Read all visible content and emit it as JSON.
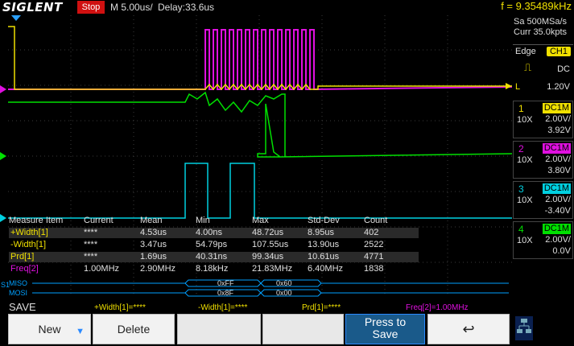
{
  "header": {
    "brand": "SIGLENT",
    "run_state": "Stop",
    "timebase": "M 5.00us/",
    "delay": "Delay:33.6us",
    "frequency": "f = 9.35489kHz"
  },
  "acq": {
    "sample_rate": "Sa 500MSa/s",
    "curr": "Curr 35.0kpts"
  },
  "trigger": {
    "mode": "Edge",
    "source": "CH1",
    "coupling": "DC",
    "level_label": "L",
    "level": "1.20V"
  },
  "channels": [
    {
      "num": "1",
      "coupling": "DC1M",
      "probe": "10X",
      "scale": "2.00V/",
      "offset": "3.92V",
      "color": "#f0e000"
    },
    {
      "num": "2",
      "coupling": "DC1M",
      "probe": "10X",
      "scale": "2.00V/",
      "offset": "3.80V",
      "color": "#e010e0"
    },
    {
      "num": "3",
      "coupling": "DC1M",
      "probe": "10X",
      "scale": "2.00V/",
      "offset": "-3.40V",
      "color": "#00d0e0"
    },
    {
      "num": "4",
      "coupling": "DC1M",
      "probe": "10X",
      "scale": "2.00V/",
      "offset": "0.0V",
      "color": "#00e000"
    }
  ],
  "measurements": {
    "headers": [
      "Measure Item",
      "Current",
      "Mean",
      "Min",
      "Max",
      "Std-Dev",
      "Count"
    ],
    "rows": [
      {
        "item": "+Width[1]",
        "current": "****",
        "mean": "4.53us",
        "min": "4.00ns",
        "max": "48.72us",
        "std": "8.95us",
        "count": "402",
        "color": "#f0e000"
      },
      {
        "item": "-Width[1]",
        "current": "****",
        "mean": "3.47us",
        "min": "54.79ps",
        "max": "107.55us",
        "std": "13.90us",
        "count": "2522",
        "color": "#f0e000"
      },
      {
        "item": "Prd[1]",
        "current": "****",
        "mean": "1.69us",
        "min": "40.31ns",
        "max": "99.34us",
        "std": "10.61us",
        "count": "4771",
        "color": "#f0e000"
      },
      {
        "item": "Freq[2]",
        "current": "1.00MHz",
        "mean": "2.90MHz",
        "min": "8.18kHz",
        "max": "21.83MHz",
        "std": "6.40MHz",
        "count": "1838",
        "color": "#e010e0"
      }
    ]
  },
  "decode": {
    "bus_label": "S1",
    "miso_label": "MISO",
    "mosi_label": "MOSI",
    "miso_values": [
      "0xFF",
      "0x60"
    ],
    "mosi_values": [
      "0x8F",
      "0x00"
    ]
  },
  "summary": {
    "w1": "+Width[1]=****",
    "w2": "-Width[1]=****",
    "prd": "Prd[1]=****",
    "freq": "Freq[2]=1.00MHz"
  },
  "menu": {
    "title": "SAVE",
    "new_label": "New",
    "delete_label": "Delete",
    "press_save_line1": "Press to",
    "press_save_line2": "Save"
  }
}
